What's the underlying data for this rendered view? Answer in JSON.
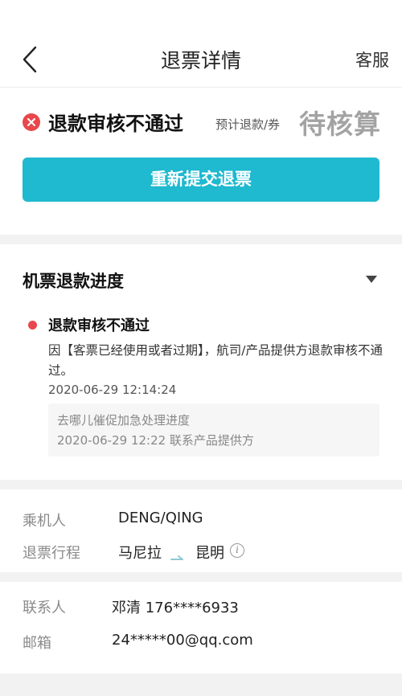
{
  "header": {
    "title": "退票详情",
    "service_label": "客服",
    "back_icon": "chevron-left-icon"
  },
  "status": {
    "icon": "error-x-icon",
    "title": "退款审核不通过",
    "refund_label": "预计退款/券",
    "refund_value": "待核算"
  },
  "actions": {
    "resubmit_label": "重新提交退票"
  },
  "progress": {
    "title": "机票退款进度",
    "toggle_icon": "caret-down-icon",
    "item": {
      "title": "退款审核不通过",
      "description": "因【客票已经使用或者过期】，航司/产品提供方退款审核不通过。",
      "time": "2020-06-29 12:14:24",
      "urge_line1": "去哪儿催促加急处理进度",
      "urge_line2": "2020-06-29 12:22 联系产品提供方"
    }
  },
  "passenger": {
    "label": "乘机人",
    "value": "DENG/QING",
    "route_label": "退票行程",
    "route_from": "马尼拉",
    "route_to": "昆明",
    "route_arrow_icon": "route-arrow-icon",
    "route_info_icon": "info-icon"
  },
  "contact": {
    "label": "联系人",
    "value": "邓清 176****6933",
    "email_label": "邮箱",
    "email_value": "24*****00@qq.com"
  },
  "colors": {
    "accent": "#1fb9d0",
    "error": "#e8474b",
    "muted": "#a3a3a3"
  }
}
